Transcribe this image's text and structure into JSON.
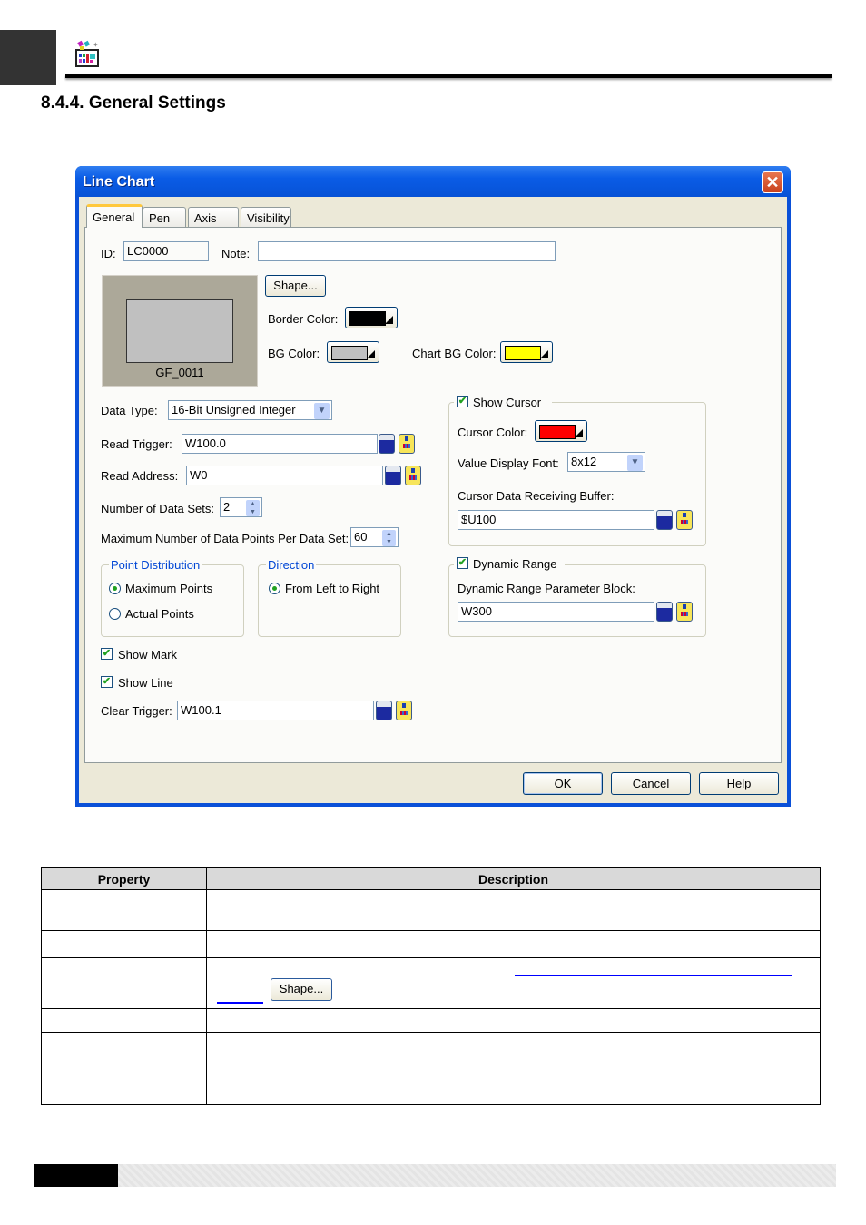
{
  "page": {
    "section_title": "8.4.4. General Settings",
    "header_icon": "line-chart-app-icon"
  },
  "dialog": {
    "title": "Line Chart",
    "close_icon": "close-icon",
    "tabs": [
      {
        "label": "General",
        "active": true
      },
      {
        "label": "Pen",
        "active": false
      },
      {
        "label": "Axis",
        "active": false
      },
      {
        "label": "Visibility",
        "active": false
      }
    ],
    "general": {
      "id_label": "ID:",
      "id_value": "LC0000",
      "note_label": "Note:",
      "note_value": "",
      "preview_label": "GF_0011",
      "shape_button": "Shape...",
      "border_color_label": "Border Color:",
      "border_color": "#000000",
      "bg_color_label": "BG Color:",
      "bg_color": "#c0c0c0",
      "chart_bg_color_label": "Chart BG Color:",
      "chart_bg_color": "#ffff00",
      "data_type_label": "Data Type:",
      "data_type_value": "16-Bit Unsigned Integer",
      "read_trigger_label": "Read Trigger:",
      "read_trigger_value": "W100.0",
      "read_address_label": "Read Address:",
      "read_address_value": "W0",
      "num_data_sets_label": "Number of Data Sets:",
      "num_data_sets_value": "2",
      "max_points_label": "Maximum Number of Data Points Per Data Set:",
      "max_points_value": "60",
      "point_distribution": {
        "legend": "Point Distribution",
        "options": [
          {
            "label": "Maximum Points",
            "selected": true
          },
          {
            "label": "Actual Points",
            "selected": false
          }
        ]
      },
      "direction": {
        "legend": "Direction",
        "options": [
          {
            "label": "From Left to Right",
            "selected": true
          }
        ]
      },
      "show_mark_label": "Show Mark",
      "show_mark_checked": true,
      "show_line_label": "Show Line",
      "show_line_checked": true,
      "clear_trigger_label": "Clear Trigger:",
      "clear_trigger_value": "W100.1",
      "show_cursor": {
        "label": "Show Cursor",
        "checked": true,
        "cursor_color_label": "Cursor Color:",
        "cursor_color": "#ff0000",
        "value_font_label": "Value Display Font:",
        "value_font_value": "8x12",
        "buffer_label": "Cursor Data Receiving Buffer:",
        "buffer_value": "$U100"
      },
      "dynamic_range": {
        "label": "Dynamic Range",
        "checked": true,
        "param_block_label": "Dynamic Range Parameter Block:",
        "param_block_value": "W300"
      }
    },
    "buttons": {
      "ok": "OK",
      "cancel": "Cancel",
      "help": "Help"
    }
  },
  "table": {
    "headers": [
      "Property",
      "Description"
    ],
    "rows": [
      {
        "property": "",
        "description": ""
      },
      {
        "property": "",
        "description": ""
      },
      {
        "property": "",
        "description": "",
        "inline_button": "Shape..."
      },
      {
        "property": "",
        "description": ""
      },
      {
        "property": "",
        "description": ""
      }
    ]
  }
}
